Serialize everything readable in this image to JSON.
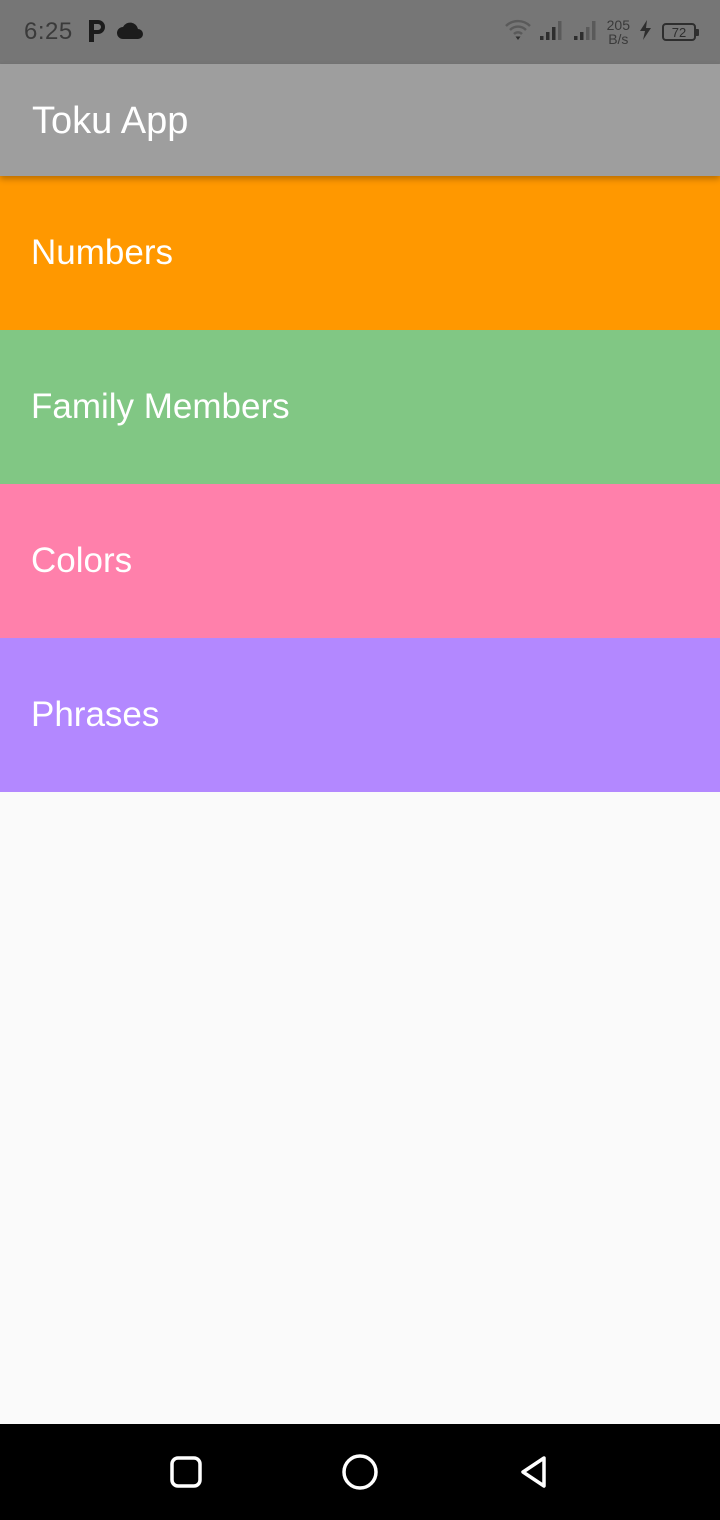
{
  "status_bar": {
    "time": "6:25",
    "net_speed_value": "205",
    "net_speed_unit": "B/s",
    "battery_level": "72",
    "icons": [
      "parking-icon",
      "cloud-icon",
      "wifi-icon",
      "signal-icon",
      "signal-icon",
      "charging-icon",
      "battery-icon"
    ]
  },
  "app_bar": {
    "title": "Toku App",
    "color": "#9e9e9e"
  },
  "categories": [
    {
      "label": "Numbers",
      "color": "#ff9800"
    },
    {
      "label": "Family Members",
      "color": "#81c784"
    },
    {
      "label": "Colors",
      "color": "#ff80ab"
    },
    {
      "label": "Phrases",
      "color": "#b388ff"
    }
  ],
  "nav_bar": {
    "buttons": [
      "recents-icon",
      "home-icon",
      "back-icon"
    ]
  }
}
